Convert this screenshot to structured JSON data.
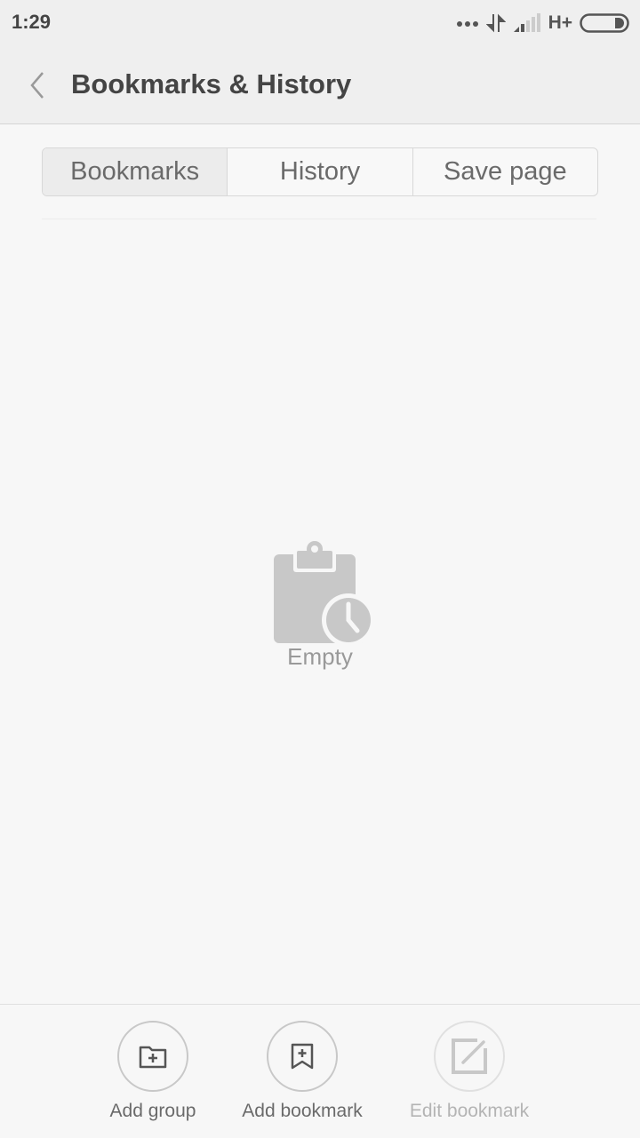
{
  "status_bar": {
    "time": "1:29",
    "network_type": "H+",
    "icons": [
      "more-dots-icon",
      "data-transfer-icon",
      "signal-icon",
      "battery-icon"
    ]
  },
  "header": {
    "title": "Bookmarks & History",
    "back_icon": "chevron-left-icon"
  },
  "tabs": [
    {
      "label": "Bookmarks",
      "active": true
    },
    {
      "label": "History",
      "active": false
    },
    {
      "label": "Save page",
      "active": false
    }
  ],
  "empty_state": {
    "icon": "clipboard-clock-icon",
    "label": "Empty"
  },
  "bottom_actions": [
    {
      "label": "Add group",
      "icon": "folder-plus-icon",
      "enabled": true
    },
    {
      "label": "Add bookmark",
      "icon": "bookmark-plus-icon",
      "enabled": true
    },
    {
      "label": "Edit bookmark",
      "icon": "edit-icon",
      "enabled": false
    }
  ],
  "colors": {
    "header_bg": "#efefef",
    "body_bg": "#f7f7f7",
    "text_dark": "#444444",
    "text_muted": "#6a6a6a",
    "icon_gray": "#c8c8c8"
  }
}
